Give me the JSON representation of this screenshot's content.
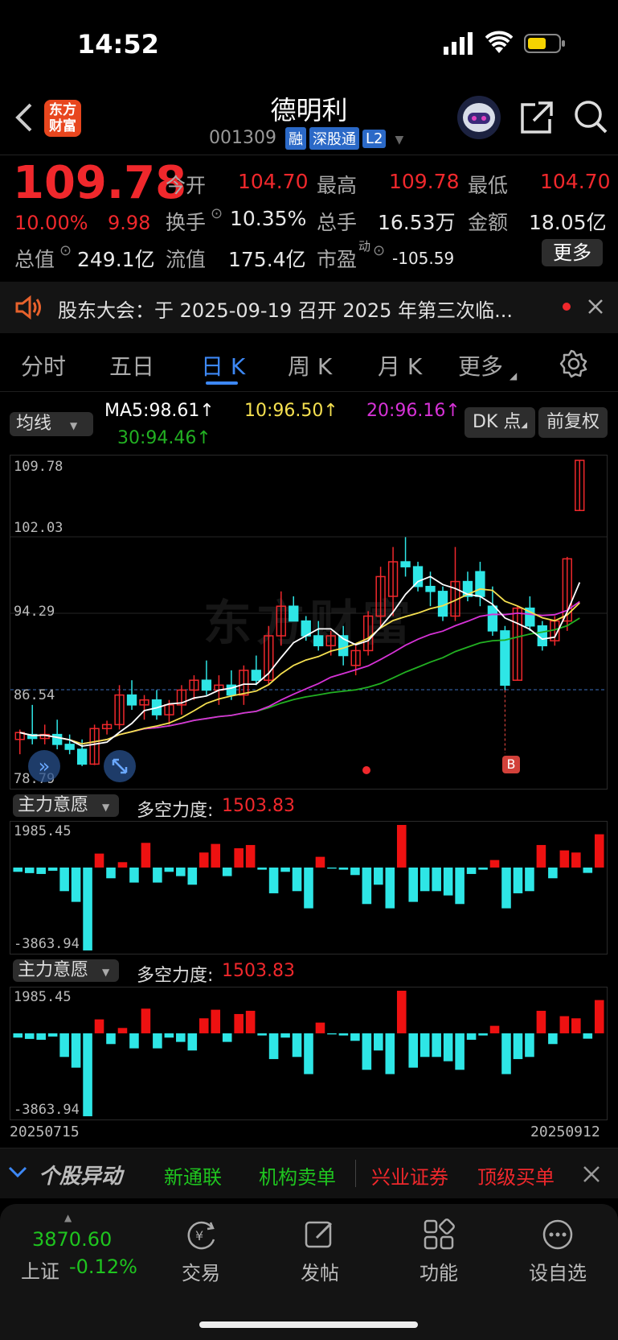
{
  "status_bar": {
    "time": "14:52"
  },
  "header": {
    "logo_line1": "东方",
    "logo_line2": "财富",
    "stock_name": "德明利",
    "stock_code": "001309",
    "badges": [
      "融",
      "深股通",
      "L2"
    ]
  },
  "quote": {
    "price": "109.78",
    "change_pct": "10.00%",
    "change_amt": "9.98",
    "stats": [
      {
        "label": "今开",
        "value": "104.70"
      },
      {
        "label": "最高",
        "value": "109.78"
      },
      {
        "label": "最低",
        "value": "104.70"
      },
      {
        "label": "换手",
        "value": "10.35%"
      },
      {
        "label": "总手",
        "value": "16.53万"
      },
      {
        "label": "金额",
        "value": "18.05亿"
      },
      {
        "label": "总值",
        "value": "249.1亿"
      },
      {
        "label": "流值",
        "value": "175.4亿"
      },
      {
        "label": "市盈",
        "sup": "动",
        "value": "-105.59"
      }
    ],
    "more_button": "更多"
  },
  "notice": {
    "text": "股东大会：于 2025-09-19 召开 2025 年第三次临..."
  },
  "tabs": {
    "items": [
      "分时",
      "五日",
      "日 K",
      "周 K",
      "月 K",
      "更多"
    ],
    "active": 2
  },
  "ma_bar": {
    "selector": "均线",
    "ma5": "MA5:98.61↑",
    "ma10": "10:96.50↑",
    "ma20": "20:96.16↑",
    "ma30": "30:94.46↑",
    "dk_button": "DK 点",
    "fq_button": "前复权",
    "colors": {
      "ma5": "#ffffff",
      "ma10": "#f5e050",
      "ma20": "#d632d6",
      "ma30": "#22b022"
    }
  },
  "main_chart": {
    "y_labels": [
      "109.78",
      "102.03",
      "94.29",
      "86.54",
      "78.79"
    ],
    "marker_b": "B"
  },
  "indicator": {
    "selector": "主力意愿",
    "label": "多空力度:",
    "value": "1503.83",
    "max": "1985.45",
    "min": "-3863.94"
  },
  "date_range": {
    "start": "20250715",
    "end": "20250912"
  },
  "ticker": {
    "title": "个股异动",
    "items_green": [
      "新通联",
      "机构卖单"
    ],
    "items_red": [
      "兴业证券",
      "顶级买单"
    ]
  },
  "index": {
    "value": "3870.60",
    "name": "上证",
    "change": "-0.12%"
  },
  "bottom_nav": [
    "交易",
    "发帖",
    "功能",
    "设自选"
  ],
  "chart_data": {
    "type": "candlestick",
    "ylim": [
      78.79,
      109.78
    ],
    "candles": [
      {
        "o": 81.5,
        "h": 82.5,
        "l": 80.0,
        "c": 82.2
      },
      {
        "o": 82.0,
        "h": 85.0,
        "l": 81.0,
        "c": 81.6
      },
      {
        "o": 81.6,
        "h": 83.0,
        "l": 81.0,
        "c": 82.0
      },
      {
        "o": 82.0,
        "h": 83.5,
        "l": 80.5,
        "c": 81.0
      },
      {
        "o": 81.0,
        "h": 82.0,
        "l": 80.0,
        "c": 80.5
      },
      {
        "o": 80.5,
        "h": 81.5,
        "l": 78.8,
        "c": 79.0
      },
      {
        "o": 79.0,
        "h": 83.0,
        "l": 78.9,
        "c": 82.6
      },
      {
        "o": 82.6,
        "h": 83.4,
        "l": 82.0,
        "c": 83.0
      },
      {
        "o": 83.0,
        "h": 87.0,
        "l": 82.5,
        "c": 86.0
      },
      {
        "o": 86.0,
        "h": 87.5,
        "l": 84.5,
        "c": 85.0
      },
      {
        "o": 85.0,
        "h": 86.0,
        "l": 83.5,
        "c": 85.5
      },
      {
        "o": 85.5,
        "h": 86.5,
        "l": 83.5,
        "c": 84.0
      },
      {
        "o": 84.0,
        "h": 85.5,
        "l": 83.0,
        "c": 85.0
      },
      {
        "o": 85.0,
        "h": 87.0,
        "l": 84.0,
        "c": 86.5
      },
      {
        "o": 86.5,
        "h": 88.0,
        "l": 85.5,
        "c": 87.5
      },
      {
        "o": 87.5,
        "h": 89.5,
        "l": 86.0,
        "c": 86.5
      },
      {
        "o": 86.5,
        "h": 88.0,
        "l": 85.0,
        "c": 87.0
      },
      {
        "o": 87.0,
        "h": 88.5,
        "l": 85.5,
        "c": 86.0
      },
      {
        "o": 86.0,
        "h": 89.0,
        "l": 85.0,
        "c": 88.5
      },
      {
        "o": 88.5,
        "h": 90.0,
        "l": 87.0,
        "c": 87.5
      },
      {
        "o": 87.5,
        "h": 93.0,
        "l": 87.0,
        "c": 92.0
      },
      {
        "o": 92.0,
        "h": 96.5,
        "l": 91.0,
        "c": 95.0
      },
      {
        "o": 95.0,
        "h": 96.0,
        "l": 93.5,
        "c": 93.5
      },
      {
        "o": 93.5,
        "h": 94.0,
        "l": 91.5,
        "c": 92.0
      },
      {
        "o": 92.0,
        "h": 93.5,
        "l": 90.5,
        "c": 91.0
      },
      {
        "o": 91.0,
        "h": 92.5,
        "l": 90.0,
        "c": 92.0
      },
      {
        "o": 92.0,
        "h": 93.0,
        "l": 89.0,
        "c": 90.0
      },
      {
        "o": 89.0,
        "h": 91.0,
        "l": 88.0,
        "c": 90.5
      },
      {
        "o": 90.5,
        "h": 94.5,
        "l": 90.0,
        "c": 94.0
      },
      {
        "o": 94.0,
        "h": 99.0,
        "l": 93.0,
        "c": 98.0
      },
      {
        "o": 96.0,
        "h": 101.0,
        "l": 94.0,
        "c": 99.5
      },
      {
        "o": 99.5,
        "h": 102.0,
        "l": 98.0,
        "c": 99.0
      },
      {
        "o": 99.0,
        "h": 99.5,
        "l": 96.5,
        "c": 97.0
      },
      {
        "o": 97.0,
        "h": 98.5,
        "l": 95.0,
        "c": 96.5
      },
      {
        "o": 96.5,
        "h": 97.0,
        "l": 93.5,
        "c": 94.0
      },
      {
        "o": 94.0,
        "h": 101.0,
        "l": 93.5,
        "c": 97.5
      },
      {
        "o": 97.5,
        "h": 98.5,
        "l": 95.5,
        "c": 96.0
      },
      {
        "o": 98.5,
        "h": 99.5,
        "l": 95.0,
        "c": 96.0
      },
      {
        "o": 95.0,
        "h": 97.0,
        "l": 92.0,
        "c": 92.5
      },
      {
        "o": 92.5,
        "h": 93.0,
        "l": 86.5,
        "c": 87.0
      },
      {
        "o": 87.5,
        "h": 95.0,
        "l": 87.5,
        "c": 94.8
      },
      {
        "o": 94.8,
        "h": 96.0,
        "l": 92.5,
        "c": 93.0
      },
      {
        "o": 93.0,
        "h": 93.5,
        "l": 90.5,
        "c": 91.0
      },
      {
        "o": 91.5,
        "h": 94.0,
        "l": 91.0,
        "c": 93.5
      },
      {
        "o": 93.5,
        "h": 100.0,
        "l": 92.5,
        "c": 99.8
      },
      {
        "o": 104.7,
        "h": 109.78,
        "l": 104.7,
        "c": 109.78
      }
    ],
    "indicator_values": [
      -200,
      -260,
      -300,
      -150,
      -1100,
      -1600,
      -3863,
      650,
      -500,
      250,
      -700,
      1150,
      -700,
      -200,
      -400,
      -800,
      700,
      1100,
      -400,
      900,
      1050,
      -100,
      -1200,
      -200,
      -1100,
      -1900,
      500,
      -50,
      -100,
      -350,
      -1700,
      -800,
      -1900,
      1985,
      -1600,
      -1100,
      -1100,
      -1300,
      -1700,
      -300,
      -100,
      350,
      -1900,
      -1200,
      -1100,
      1050,
      -500,
      800,
      700,
      -250,
      1550
    ]
  }
}
